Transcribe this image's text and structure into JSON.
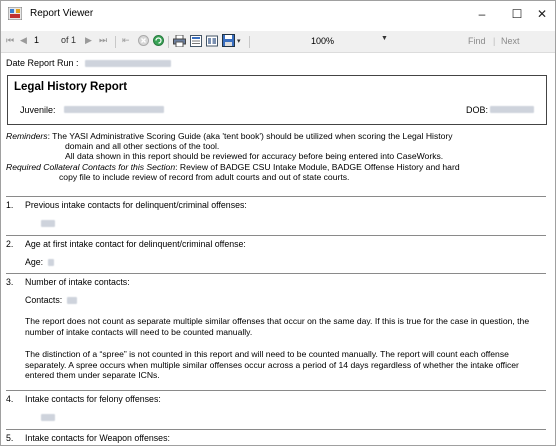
{
  "window": {
    "title": "Report Viewer",
    "controls": {
      "minimize": "–",
      "maximize": "☐",
      "close": "✕"
    }
  },
  "toolbar": {
    "current_page": "1",
    "of_label": "of 1",
    "zoom": "100%",
    "find": "Find",
    "separator": "|",
    "next": "Next"
  },
  "report": {
    "date_run_label": "Date Report Run :",
    "title": "Legal History Report",
    "juvenile_label": "Juvenile:",
    "dob_label": "DOB:",
    "reminders": {
      "label": "Reminders",
      "line1": ": The YASI Administrative Scoring Guide (aka 'tent book') should be utilized when scoring the Legal History",
      "line2": "domain and all other sections of the tool.",
      "line3": "All data shown in this report should be reviewed for accuracy before being entered into CaseWorks.",
      "collateral_label": "Required Collateral Contacts for this Section",
      "line4": ": Review of BADGE CSU Intake Module, BADGE Offense History and hard",
      "line5": "copy file to include review of record from adult courts and out of state courts."
    },
    "items": [
      {
        "num": "1.",
        "question": "Previous intake contacts for delinquent/criminal offenses:"
      },
      {
        "num": "2.",
        "question": "Age at first intake contact for delinquent/criminal offense:",
        "sub_label": "Age:"
      },
      {
        "num": "3.",
        "question": "Number of intake contacts:",
        "sub_label": "Contacts:",
        "para1": "The report does not count as separate multiple similar offenses that occur on the same day. If this is true for the case in question, the number of intake contacts will need to be counted manually.",
        "para2": "The distinction of a “spree” is not counted in this report and will need to be counted manually. The report will count each offense separately. A spree occurs when multiple similar offenses occur across a period of 14 days regardless of whether the intake officer entered them under separate ICNs."
      },
      {
        "num": "4.",
        "question": "Intake contacts for felony offenses:"
      },
      {
        "num": "5.",
        "question": "Intake contacts for Weapon offenses:"
      }
    ]
  },
  "colors": {
    "accent_icon": "#2f6db5",
    "rule": "#8a8a8a",
    "redaction": "#c6ccd6"
  }
}
